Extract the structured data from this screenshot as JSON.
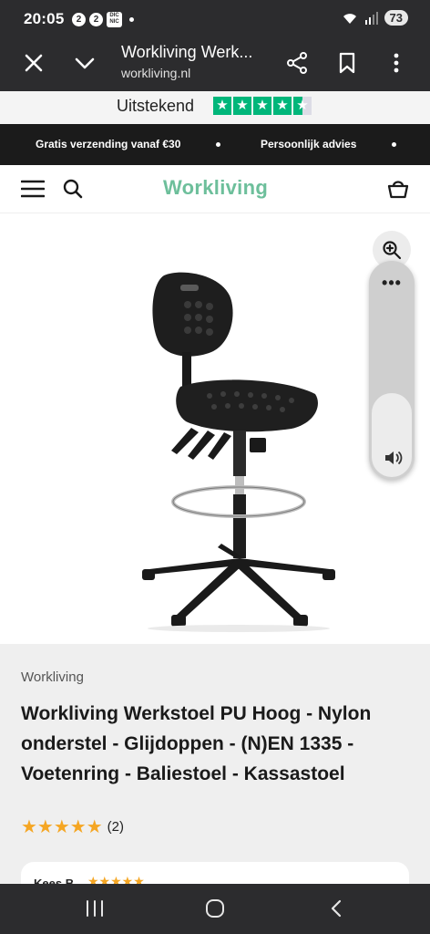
{
  "status_bar": {
    "time": "20:05",
    "notif_1": "2",
    "notif_2": "2",
    "notif_3": "DIC\nNIC",
    "battery": "73"
  },
  "browser": {
    "title": "Workliving Werk...",
    "url": "workliving.nl"
  },
  "trustpilot": {
    "label": "Uitstekend",
    "stars": 4.5,
    "color": "#00b67a"
  },
  "promo": {
    "item_1": "Gratis verzending vanaf €30",
    "item_2": "Persoonlijk advies"
  },
  "header": {
    "logo": "Workliving",
    "logo_color": "#6dbf9b"
  },
  "product": {
    "brand": "Workliving",
    "title": "Workliving Werkstoel PU Hoog - Nylon onderstel - Glijdoppen - (N)EN 1335 - Voetenring - Baliestoel - Kassastoel",
    "rating_stars": "★★★★★",
    "rating": 5,
    "review_count": "(2)",
    "star_color": "#f5a623"
  },
  "review": {
    "author": "Kees B.",
    "stars": "★★★★★"
  },
  "icons": {
    "close": "close-icon",
    "chevron": "chevron-down-icon",
    "share": "share-icon",
    "bookmark": "bookmark-icon",
    "more": "more-vertical-icon",
    "menu": "hamburger-icon",
    "search": "search-icon",
    "cart": "basket-icon",
    "zoom": "zoom-in-icon",
    "speaker": "speaker-icon"
  }
}
